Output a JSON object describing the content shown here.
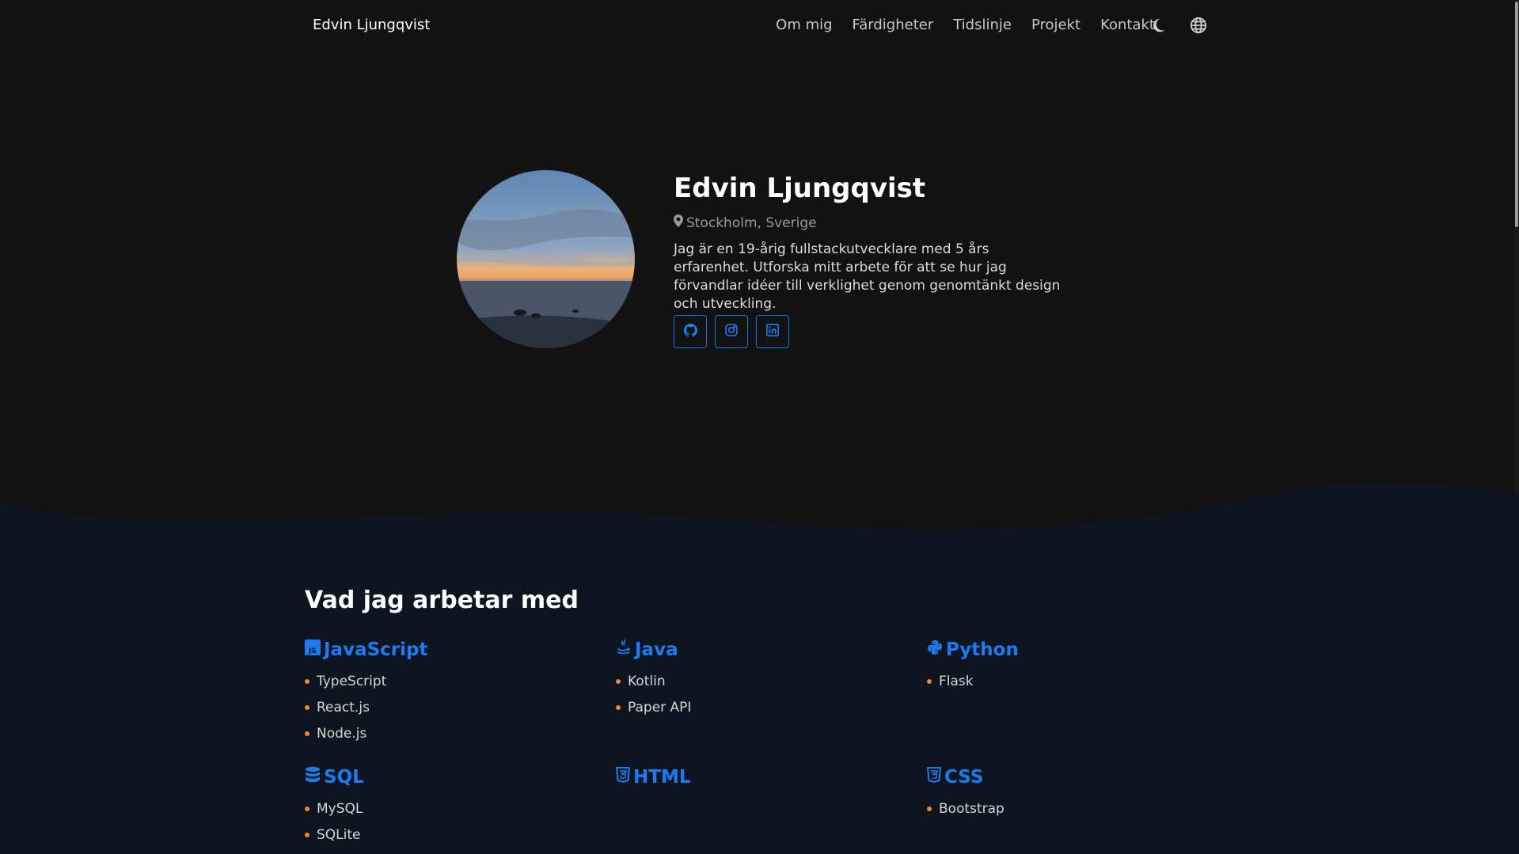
{
  "nav": {
    "brand": "Edvin Ljungqvist",
    "links": [
      "Om mig",
      "Färdigheter",
      "Tidslinje",
      "Projekt",
      "Kontakt"
    ],
    "icons": [
      "moon-icon",
      "globe-icon"
    ]
  },
  "hero": {
    "name": "Edvin Ljungqvist",
    "location": "Stockholm, Sverige",
    "bio": "Jag är en 19-årig fullstackutvecklare med 5 års erfarenhet. Utforska mitt arbete för att se hur jag förvandlar idéer till verklighet genom genomtänkt design och utveckling.",
    "socials": [
      "github-icon",
      "instagram-icon",
      "linkedin-icon"
    ]
  },
  "skills": {
    "title": "Vad jag arbetar med",
    "groups": [
      {
        "name": "JavaScript",
        "icon": "js-icon",
        "items": [
          "TypeScript",
          "React.js",
          "Node.js"
        ]
      },
      {
        "name": "Java",
        "icon": "java-icon",
        "items": [
          "Kotlin",
          "Paper API"
        ]
      },
      {
        "name": "Python",
        "icon": "python-icon",
        "items": [
          "Flask"
        ]
      },
      {
        "name": "SQL",
        "icon": "database-icon",
        "items": [
          "MySQL",
          "SQLite"
        ]
      },
      {
        "name": "HTML",
        "icon": "html5-icon",
        "items": []
      },
      {
        "name": "CSS",
        "icon": "css3-icon",
        "items": [
          "Bootstrap"
        ]
      }
    ]
  },
  "colors": {
    "accent": "#1a7cf0",
    "bullet": "#f0892a",
    "background": "#121212",
    "section_background": "#0f1520"
  }
}
